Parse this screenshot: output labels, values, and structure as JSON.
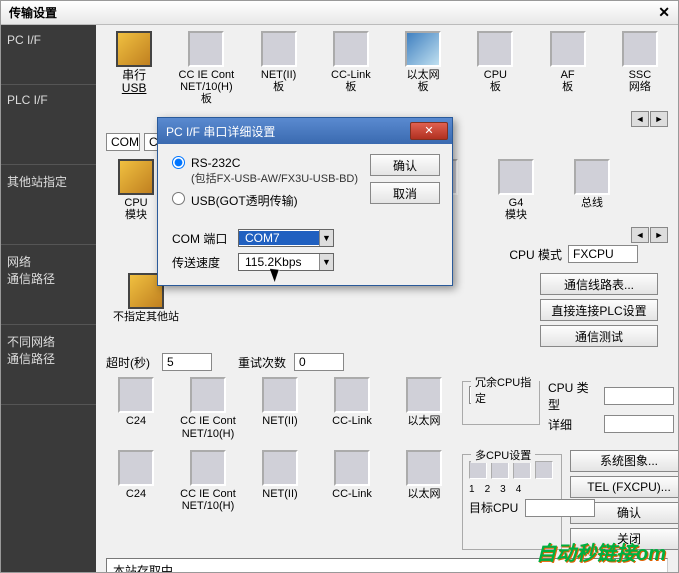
{
  "window": {
    "title": "传输设置",
    "close": "✕"
  },
  "sidebar": [
    {
      "label": "PC I/F"
    },
    {
      "label": "PLC I/F"
    },
    {
      "label": "其他站指定"
    },
    {
      "label": "网络\n通信路径"
    },
    {
      "label": "不同网络\n通信路径"
    }
  ],
  "row1": [
    {
      "label": "串行",
      "sub": "USB",
      "style": "yellow"
    },
    {
      "label": "CC IE Cont\nNET/10(H)板",
      "style": ""
    },
    {
      "label": "NET(II)\n板",
      "style": ""
    },
    {
      "label": "CC-Link\n板",
      "style": ""
    },
    {
      "label": "以太网\n板",
      "style": "net"
    },
    {
      "label": "CPU\n板",
      "style": ""
    },
    {
      "label": "AF\n板",
      "style": ""
    },
    {
      "label": "SSC\n网络",
      "style": ""
    }
  ],
  "com_row": {
    "com": "COM",
    "com_val": "COM7",
    "baud_val": "115.2Kbps"
  },
  "row2": [
    {
      "label": "CPU\n模块",
      "style": "yellow"
    },
    {
      "label": "",
      "style": ""
    },
    {
      "label": "",
      "style": ""
    },
    {
      "label": "",
      "style": ""
    },
    {
      "label": "",
      "style": ""
    },
    {
      "label": "G4\n模块",
      "style": ""
    },
    {
      "label": "总线",
      "style": ""
    }
  ],
  "cpu_mode": {
    "label": "CPU 模式",
    "value": "FXCPU"
  },
  "row3": {
    "label": "不指定其他站",
    "style": "yellow"
  },
  "timeouts": {
    "timeout_label": "超时(秒)",
    "timeout_val": "5",
    "retry_label": "重试次数",
    "retry_val": "0"
  },
  "right_buttons": [
    "通信线路表...",
    "直接连接PLC设置",
    "通信测试"
  ],
  "row4": [
    {
      "label": "C24"
    },
    {
      "label": "CC IE Cont\nNET/10(H)"
    },
    {
      "label": "NET(II)"
    },
    {
      "label": "CC-Link"
    },
    {
      "label": "以太网"
    }
  ],
  "group_redundant": {
    "legend": "冗余CPU指定"
  },
  "cpu_type": {
    "label": "CPU 类型",
    "detail": "详细"
  },
  "row5": [
    {
      "label": "C24"
    },
    {
      "label": "CC IE Cont\nNET/10(H)"
    },
    {
      "label": "NET(II)"
    },
    {
      "label": "CC-Link"
    },
    {
      "label": "以太网"
    }
  ],
  "group_multicpu": {
    "legend": "多CPU设置",
    "nums": [
      "1",
      "2",
      "3",
      "4"
    ],
    "target": "目标CPU"
  },
  "right_buttons2": [
    "系统图象...",
    "TEL (FXCPU)...",
    "确认",
    "关闭"
  ],
  "status": "本站存取中。",
  "modal": {
    "title": "PC I/F 串口详细设置",
    "rs232": "RS-232C",
    "rs232_note": "(包括FX-USB-AW/FX3U-USB-BD)",
    "usb": "USB(GOT透明传输)",
    "com_label": "COM 端口",
    "com_value": "COM7",
    "baud_label": "传送速度",
    "baud_value": "115.2Kbps",
    "ok": "确认",
    "cancel": "取消",
    "close": "✕"
  },
  "watermark": "自动秒链接om"
}
